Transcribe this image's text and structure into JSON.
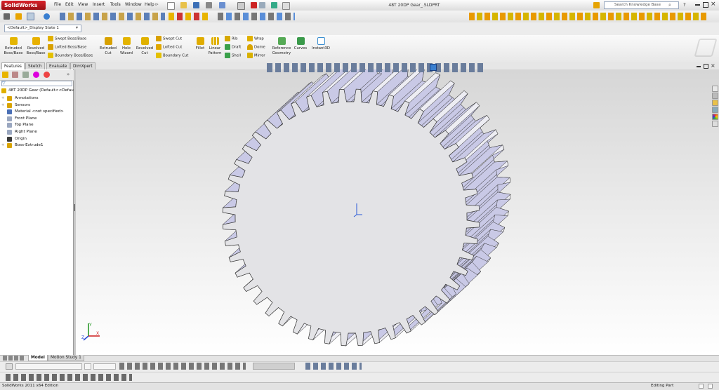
{
  "app": {
    "brand": "SolidWorks",
    "menu": [
      "File",
      "Edit",
      "View",
      "Insert",
      "Tools",
      "Window",
      "Help"
    ],
    "document_title": "48T 20DP Gear_.SLDPRT",
    "search_placeholder": "Search Knowledge Base",
    "help_label": "?"
  },
  "configuration": {
    "selected": "<Default>_Display State 1"
  },
  "command_manager": {
    "extruded_boss": "Extruded Boss/Base",
    "revolved_boss": "Revolved Boss/Base",
    "swept_boss": "Swept Boss/Base",
    "lofted_boss": "Lofted Boss/Base",
    "boundary_boss": "Boundary Boss/Base",
    "extruded_cut": "Extruded Cut",
    "hole_wizard": "Hole Wizard",
    "revolved_cut": "Revolved Cut",
    "swept_cut": "Swept Cut",
    "lofted_cut": "Lofted Cut",
    "boundary_cut": "Boundary Cut",
    "fillet": "Fillet",
    "linear_pattern": "Linear Pattern",
    "rib": "Rib",
    "draft": "Draft",
    "shell": "Shell",
    "wrap": "Wrap",
    "dome": "Dome",
    "mirror": "Mirror",
    "reference_geometry": "Reference Geometry",
    "curves": "Curves",
    "instant3d": "Instant3D"
  },
  "tabs": [
    {
      "label": "Features",
      "active": true
    },
    {
      "label": "Sketch",
      "active": false
    },
    {
      "label": "Evaluate",
      "active": false
    },
    {
      "label": "DimXpert",
      "active": false
    }
  ],
  "feature_tree": {
    "root": "48T 20DP Gear  (Default<<Defau",
    "items": [
      {
        "label": "Annotations",
        "icon": "annotations-icon",
        "color": "#d9a400"
      },
      {
        "label": "Sensors",
        "icon": "sensors-icon",
        "color": "#d9a400"
      },
      {
        "label": "Material <not specified>",
        "icon": "material-icon",
        "color": "#4a6fb5"
      },
      {
        "label": "Front Plane",
        "icon": "plane-icon",
        "color": "#9aa7c0"
      },
      {
        "label": "Top Plane",
        "icon": "plane-icon",
        "color": "#9aa7c0"
      },
      {
        "label": "Right Plane",
        "icon": "plane-icon",
        "color": "#9aa7c0"
      },
      {
        "label": "Origin",
        "icon": "origin-icon",
        "color": "#3a3a3a"
      },
      {
        "label": "Boss-Extrude1",
        "icon": "boss-extrude-icon",
        "color": "#d9a400"
      }
    ]
  },
  "bottom_tabs": [
    {
      "label": "Model",
      "active": true
    },
    {
      "label": "Motion Study 1",
      "active": false
    }
  ],
  "status": {
    "left": "SolidWorks 2011 x64 Edition",
    "right": "Editing Part"
  },
  "gear": {
    "teeth": 48
  },
  "colors": {
    "brand_red": "#c0171d",
    "gear_face": "#e3e3e6",
    "gear_flank": "#c9c9e6"
  }
}
